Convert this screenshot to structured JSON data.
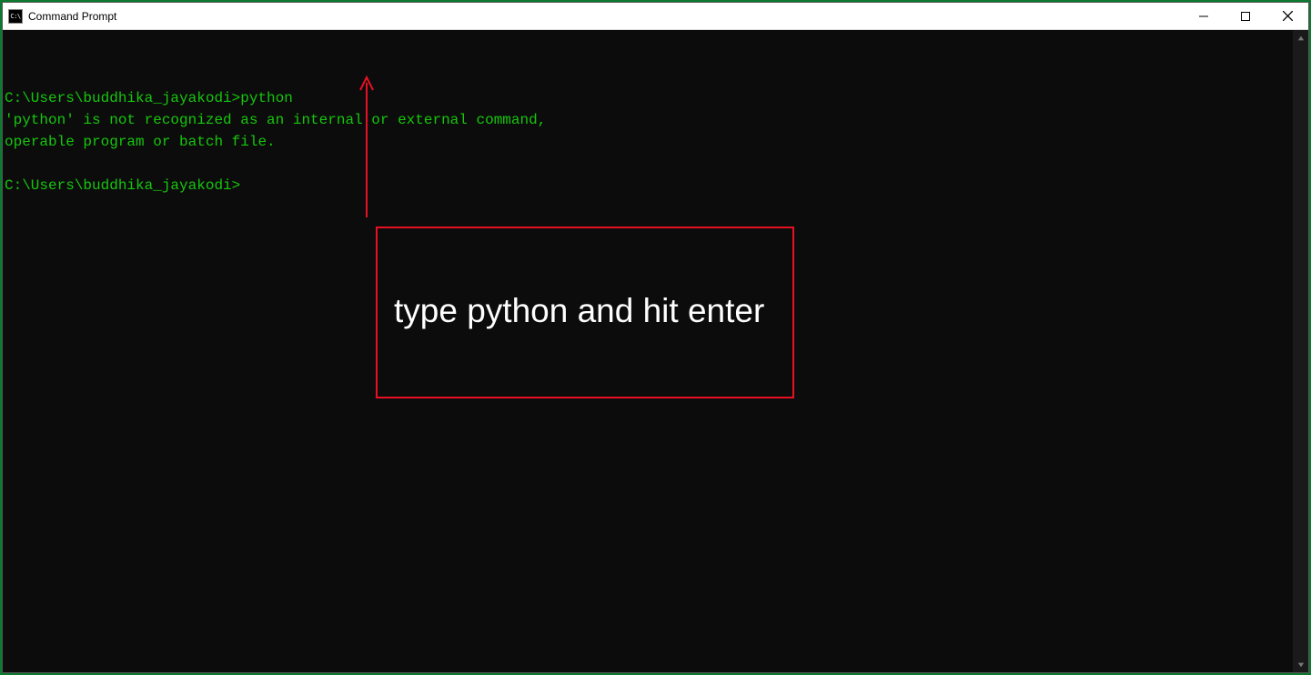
{
  "window": {
    "title": "Command Prompt",
    "icon_glyph": "C:\\",
    "controls": {
      "minimize": "—",
      "maximize": "☐",
      "close": "✕"
    }
  },
  "terminal": {
    "lines": [
      {
        "prompt": "C:\\Users\\buddhika_jayakodi>",
        "command": "python"
      },
      {
        "text": "'python' is not recognized as an internal or external command,"
      },
      {
        "text": "operable program or batch file."
      },
      {
        "text": ""
      },
      {
        "prompt": "C:\\Users\\buddhika_jayakodi>",
        "command": ""
      }
    ]
  },
  "annotation": {
    "text": "type python and hit enter"
  },
  "colors": {
    "terminal_fg": "#16c60c",
    "terminal_bg": "#0c0c0c",
    "annotation_red": "#e81123"
  }
}
